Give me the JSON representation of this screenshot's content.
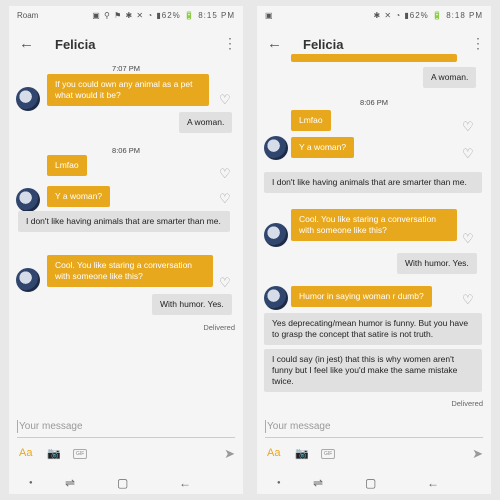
{
  "left": {
    "status": {
      "carrier": "Roam",
      "icons": "▣ ⚲ ⚑ ✱ ✕ ◔ ▮62% 🔋 8:15 PM"
    },
    "header": {
      "title": "Felicia"
    },
    "time1": "7:07 PM",
    "m1": "If you could own any animal as a pet what would it be?",
    "m2": "A woman.",
    "time2": "8:06 PM",
    "m3": "Lmfao",
    "m4": "Y a woman?",
    "m5": "I don't like having animals that are smarter than me.",
    "m6": "Cool. You like staring a conversation with someone like this?",
    "m7": "With humor. Yes.",
    "delivered": "Delivered",
    "input": {
      "placeholder": "Your message"
    }
  },
  "right": {
    "status": {
      "icons": "✱ ✕ ◔ ▮62% 🔋 8:18 PM"
    },
    "header": {
      "title": "Felicia"
    },
    "m1": "A woman.",
    "time1": "8:06 PM",
    "m2": "Lmfao",
    "m3": "Y a woman?",
    "m4": "I don't like having animals that are smarter than me.",
    "m5": "Cool. You like staring a conversation with someone like this?",
    "m6": "With humor. Yes.",
    "m7": "Humor in saying woman r dumb?",
    "m8": "Yes deprecating/mean humor is funny. But you have to grasp the concept that satire is not truth.",
    "m9": "I could say (in jest) that this is why women aren't funny but I feel like you'd make the same mistake twice.",
    "delivered": "Delivered",
    "input": {
      "placeholder": "Your message"
    }
  },
  "toolbar": {
    "aa_label": "Aa",
    "gif_label": "GIF"
  },
  "icons": {
    "back": "back-arrow-icon",
    "menu": "more-vert-icon",
    "heart": "heart-icon",
    "camera": "camera-icon",
    "send": "send-icon",
    "nav_recent": "recent-apps-icon",
    "nav_home": "home-icon",
    "nav_back": "nav-back-icon"
  },
  "colors": {
    "accent": "#e8a81e",
    "incoming": "#e0e0e0",
    "background": "#f5f5f5"
  }
}
